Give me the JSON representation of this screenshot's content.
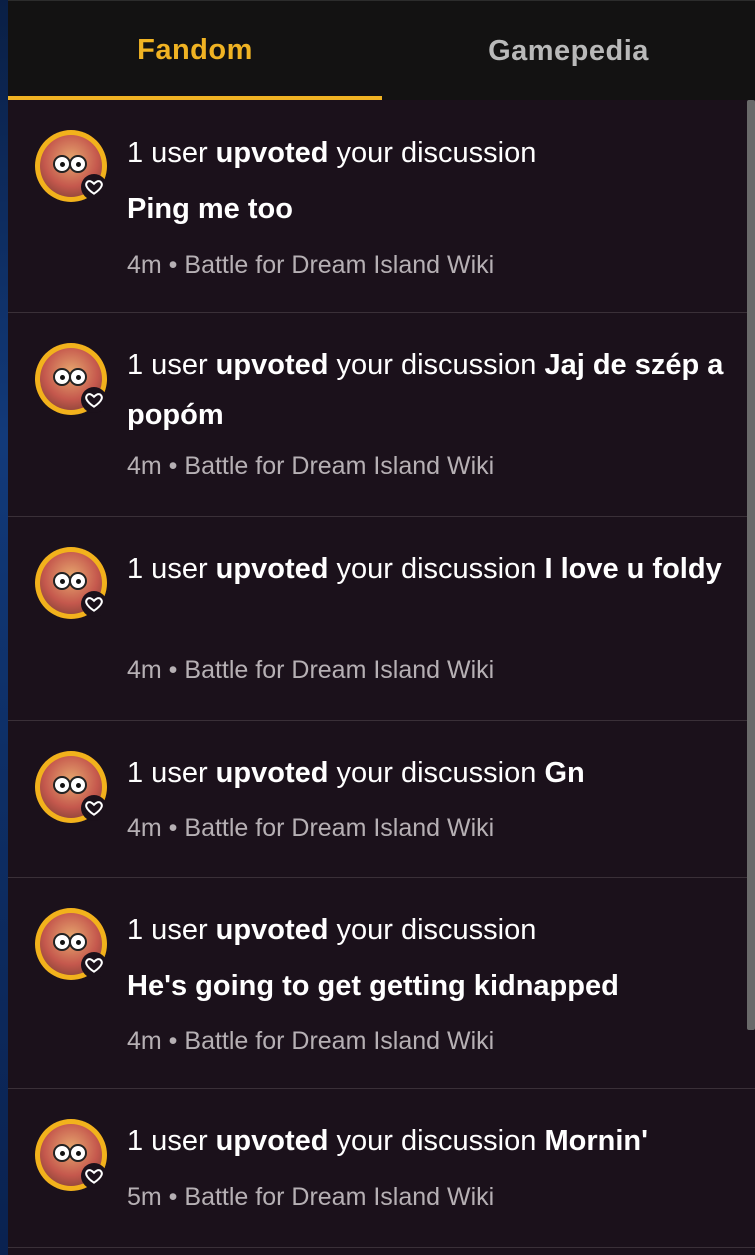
{
  "tabs": {
    "fandom": "Fandom",
    "gamepedia": "Gamepedia"
  },
  "colors": {
    "accent": "#f0b323",
    "panel_bg": "#1b111b",
    "tab_bg": "#131212",
    "muted_text": "#b6b0b4"
  },
  "notifications": [
    {
      "prefix": "1 user ",
      "action": "upvoted",
      "middle": " your discussion",
      "title": "Ping me too",
      "time": "4m",
      "separator": " • ",
      "wiki": "Battle for Dream Island Wiki"
    },
    {
      "prefix": "1 user ",
      "action": "upvoted",
      "middle": " your discussion ",
      "title": "Jaj de szép a popóm",
      "time": "4m",
      "separator": " • ",
      "wiki": "Battle for Dream Island Wiki"
    },
    {
      "prefix": "1 user ",
      "action": "upvoted",
      "middle": " your discussion ",
      "title": "I love u foldy",
      "time": "4m",
      "separator": " • ",
      "wiki": "Battle for Dream Island Wiki"
    },
    {
      "prefix": "1 user ",
      "action": "upvoted",
      "middle": " your discussion ",
      "title": "Gn",
      "time": "4m",
      "separator": " • ",
      "wiki": "Battle for Dream Island Wiki"
    },
    {
      "prefix": "1 user ",
      "action": "upvoted",
      "middle": " your discussion",
      "title": "He's going to get getting kidnapped",
      "time": "4m",
      "separator": " • ",
      "wiki": "Battle for Dream Island Wiki"
    },
    {
      "prefix": "1 user ",
      "action": "upvoted",
      "middle": " your discussion ",
      "title": "Mornin'",
      "time": "5m",
      "separator": " • ",
      "wiki": "Battle for Dream Island Wiki"
    }
  ]
}
